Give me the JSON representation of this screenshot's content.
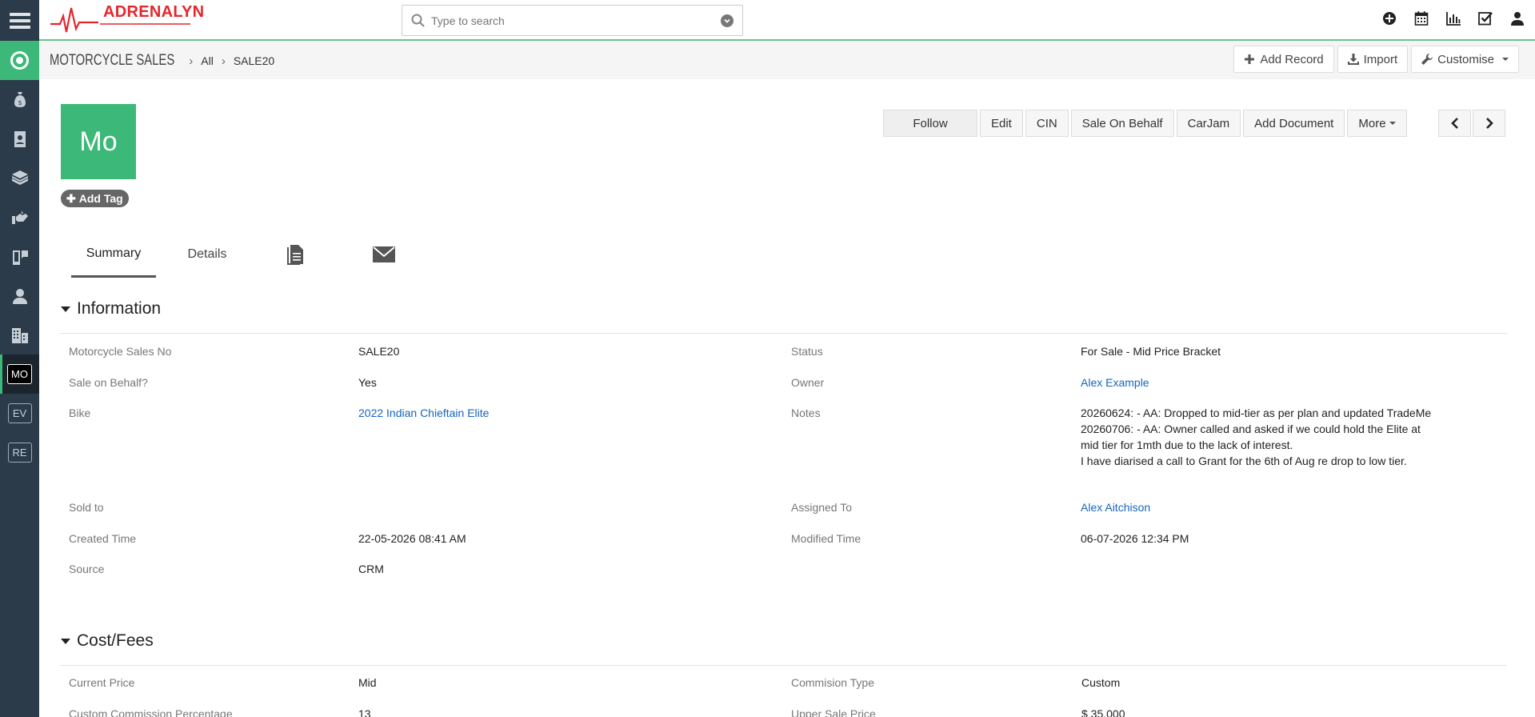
{
  "app": {
    "logo_text": "ADRENALYN",
    "brand_color": "#e4262c",
    "accent_color": "#3cb878"
  },
  "search": {
    "placeholder": "Type to search"
  },
  "sidebar": {
    "icons": [
      "menu-icon",
      "home-icon",
      "money-bag-icon",
      "contacts-icon",
      "products-icon",
      "handshake-icon",
      "devices-icon",
      "user-icon",
      "organization-icon"
    ],
    "modules": [
      {
        "label": "MO",
        "active": true
      },
      {
        "label": "EV",
        "active": false
      },
      {
        "label": "RE",
        "active": false
      }
    ]
  },
  "top_icons": [
    "add-circle-icon",
    "calendar-icon",
    "reports-icon",
    "tasks-icon",
    "user-icon"
  ],
  "breadcrumb": {
    "module": "Motorcycle Sales",
    "filter": "All",
    "record": "SALE20"
  },
  "header_buttons": {
    "add_record": "Add Record",
    "import": "Import",
    "customise": "Customise"
  },
  "record": {
    "avatar_text": "Mo",
    "add_tag": "Add Tag",
    "actions": {
      "follow": "Follow",
      "edit": "Edit",
      "cin": "CIN",
      "sale_on_behalf": "Sale On Behalf",
      "carjam": "CarJam",
      "add_document": "Add Document",
      "more": "More"
    }
  },
  "tabs": {
    "summary": "Summary",
    "details": "Details",
    "documents_icon": "document-icon",
    "email_icon": "envelope-icon"
  },
  "information": {
    "title": "Information",
    "left": [
      {
        "label": "Motorcycle Sales No",
        "value": "SALE20"
      },
      {
        "label": "Sale on Behalf?",
        "value": "Yes"
      },
      {
        "label": "Bike",
        "value": "2022 Indian Chieftain Elite"
      },
      {
        "label": "Sold to",
        "value": ""
      },
      {
        "label": "Created Time",
        "value": "22-05-2026 08:41 AM"
      },
      {
        "label": "Source",
        "value": "CRM"
      }
    ],
    "right": [
      {
        "label": "Status",
        "value": "For Sale - Mid Price Bracket"
      },
      {
        "label": "Owner",
        "value": "Alex Example"
      },
      {
        "label": "Notes",
        "value_lines": [
          "20260624: - AA: Dropped to mid-tier as per plan and updated TradeMe",
          "20260706: - AA: Owner called and asked if we could hold the Elite at mid tier for 1mth due to the lack of interest.",
          "I have diarised a call to Grant for the 6th of Aug re drop to low tier."
        ]
      },
      {
        "label": "Assigned To",
        "value": "Alex Aitchison"
      },
      {
        "label": "Modified Time",
        "value": "06-07-2026 12:34 PM"
      }
    ]
  },
  "cost_fees": {
    "title": "Cost/Fees",
    "left": [
      {
        "label": "Current Price",
        "value": "Mid"
      },
      {
        "label": "Custom Commission Percentage",
        "value": "13"
      }
    ],
    "right": [
      {
        "label": "Commision Type",
        "value": "Custom"
      },
      {
        "label": "Upper Sale Price",
        "value": "$ 35,000"
      }
    ]
  }
}
